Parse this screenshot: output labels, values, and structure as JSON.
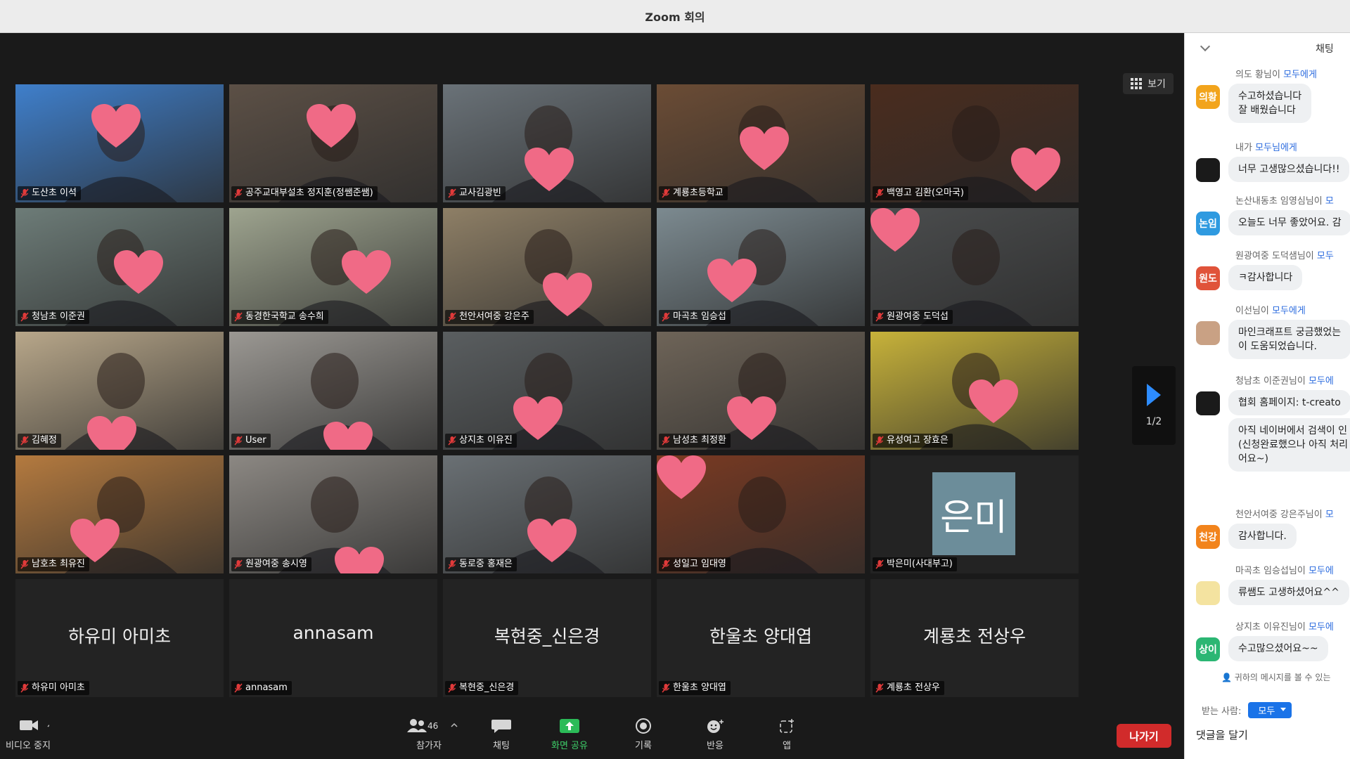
{
  "window": {
    "title": "Zoom 회의"
  },
  "meeting": {
    "view_label": "보기",
    "page_indicator": "1/2",
    "tiles": [
      {
        "name": "도산초 이석",
        "kind": "video",
        "bg": "#3f7fcb"
      },
      {
        "name": "공주교대부설초 정지훈(정쌤준쌤)",
        "kind": "video",
        "bg": "#5c5046"
      },
      {
        "name": "교사김광빈",
        "kind": "video",
        "bg": "#6a7278"
      },
      {
        "name": "계룡초등학교",
        "kind": "video",
        "bg": "#6b4c35",
        "active": true
      },
      {
        "name": "백영고 김환(오마국)",
        "kind": "video",
        "bg": "#4a2c1e"
      },
      {
        "name": "청남초 이준권",
        "kind": "video",
        "bg": "#6d7c78"
      },
      {
        "name": "동경한국학교 송수희",
        "kind": "video",
        "bg": "#9ea48f"
      },
      {
        "name": "천안서여중 강은주",
        "kind": "video",
        "bg": "#8e7f66"
      },
      {
        "name": "마곡초 임승섭",
        "kind": "video",
        "bg": "#7c8a90"
      },
      {
        "name": "원광여중 도덕섭",
        "kind": "video",
        "bg": "#4b4d4e"
      },
      {
        "name": "김혜정",
        "kind": "video",
        "bg": "#b8a78a"
      },
      {
        "name": "User",
        "kind": "video",
        "bg": "#9b9893"
      },
      {
        "name": "상지초 이유진",
        "kind": "video",
        "bg": "#5a5e60"
      },
      {
        "name": "남성초 최정환",
        "kind": "video",
        "bg": "#6e6458"
      },
      {
        "name": "유성여고 장효은",
        "kind": "video",
        "bg": "#c7b23a"
      },
      {
        "name": "남호초 최유진",
        "kind": "video",
        "bg": "#b47a3f"
      },
      {
        "name": "원광여중 송시영",
        "kind": "video",
        "bg": "#8c8883"
      },
      {
        "name": "동로중 홍재은",
        "kind": "video",
        "bg": "#6a7074"
      },
      {
        "name": "성일고 임대영",
        "kind": "video",
        "bg": "#7a3a22"
      },
      {
        "name": "박은미(사대부고)",
        "kind": "avatar",
        "avatar_text": "은미"
      },
      {
        "name": "하유미 아미초",
        "kind": "name",
        "display": "하유미 아미초"
      },
      {
        "name": "annasam",
        "kind": "name",
        "display": "annasam"
      },
      {
        "name": "복현중_신은경",
        "kind": "name",
        "display": "복현중_신은경"
      },
      {
        "name": "한울초 양대엽",
        "kind": "name",
        "display": "한울초 양대엽"
      },
      {
        "name": "계룡초 전상우",
        "kind": "name",
        "display": "계룡초 전상우"
      }
    ]
  },
  "toolbar": {
    "video": "비디오 중지",
    "participants": "참가자",
    "participants_count": "46",
    "chat": "채팅",
    "share": "화면 공유",
    "record": "기록",
    "reactions": "반응",
    "apps": "앱",
    "leave": "나가기"
  },
  "chat": {
    "title": "채팅",
    "messages": [
      {
        "from": "의도 황님이",
        "to": "모두에게",
        "avatar": "의황",
        "avatar_color": "#f2a41c",
        "text": "수고하셨습니다\n잘 배웠습니다"
      },
      {
        "from": "내가",
        "to": "모두님에게",
        "avatar": "",
        "avatar_color": "#1a1a1a",
        "text": "너무 고생많으셨습니다!!"
      },
      {
        "from": "논산내동초 임영심님이",
        "to": "모",
        "avatar": "논임",
        "avatar_color": "#2f9ae0",
        "text": "오늘도 너무 좋았어요. 감"
      },
      {
        "from": "원광여중 도덕샘님이",
        "to": "모두",
        "avatar": "원도",
        "avatar_color": "#e0533a",
        "text": "ㅋ감사합니다"
      },
      {
        "from": "이선님이",
        "to": "모두에게",
        "avatar": "",
        "avatar_color": "#c9a184",
        "text": "마인크래프트 궁금했었는\n이 도움되었습니다."
      },
      {
        "from": "청남초 이준권님이",
        "to": "모두에",
        "avatar": "",
        "avatar_color": "#1a1a1a",
        "text": "협회 홈페이지: t-creato"
      },
      {
        "from": "",
        "to": "",
        "avatar": "",
        "avatar_color": "",
        "text": "아직 네이버에서 검색이 인\n(신청완료했으나 아직 처리\n어요~)"
      },
      {
        "from": "천안서여중 강은주님이",
        "to": "모",
        "avatar": "천강",
        "avatar_color": "#f2841c",
        "text": "감사합니다."
      },
      {
        "from": "마곡초 임승섭님이",
        "to": "모두에",
        "avatar": "",
        "avatar_color": "#f4e3a0",
        "text": "류쌤도 고생하셨어요^^"
      },
      {
        "from": "상지초 이유진님이",
        "to": "모두에",
        "avatar": "상이",
        "avatar_color": "#2bb673",
        "text": "수고많으셨어요~~"
      }
    ],
    "footer_note": "귀하의 메시지를 볼 수 있는 ",
    "recipient_label": "받는 사람:",
    "recipient_value": "모두",
    "input_value": "댓글을 달기"
  }
}
